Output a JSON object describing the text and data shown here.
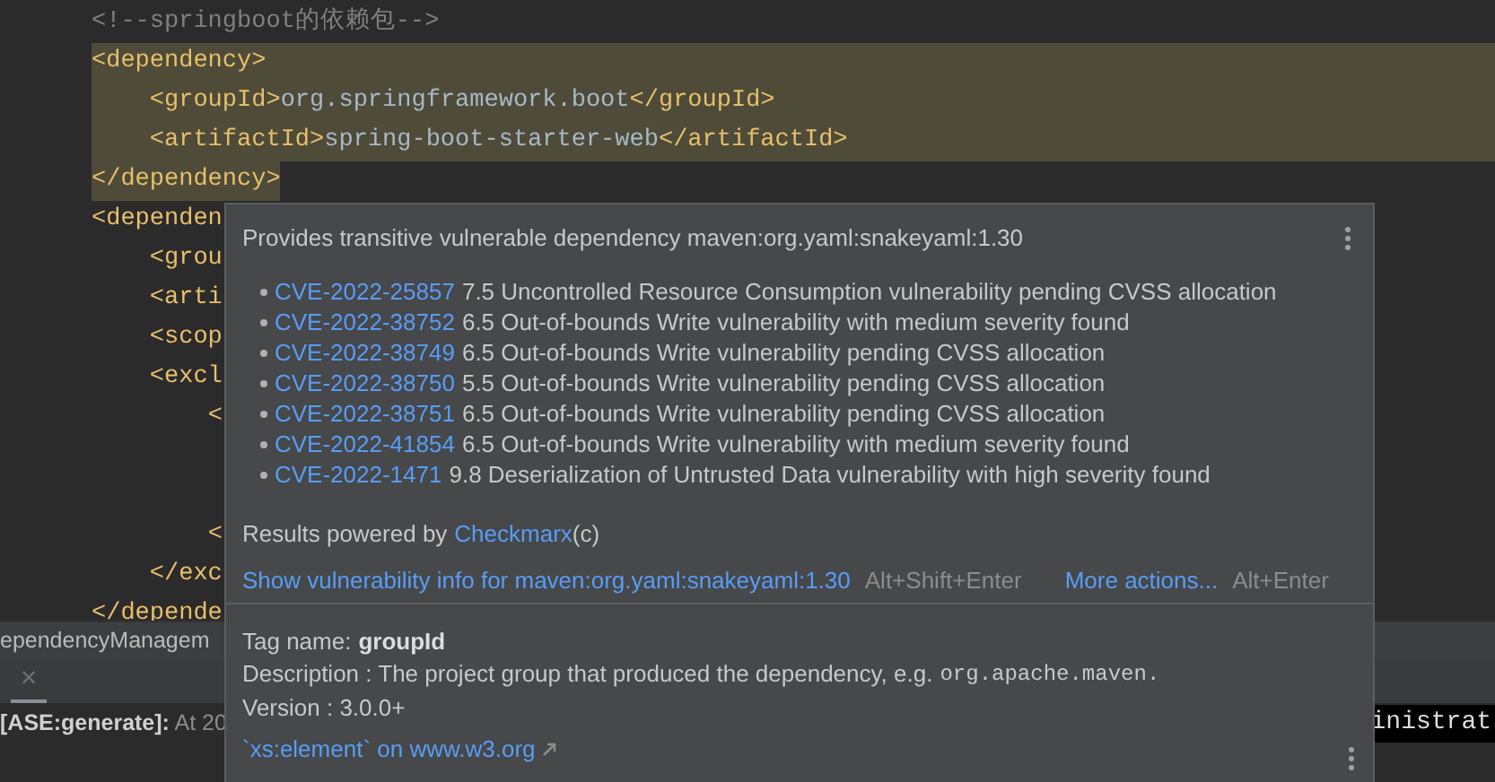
{
  "editor": {
    "lines": [
      {
        "text": "<!--springboot的依赖包-->",
        "kind": "comment",
        "selected": false
      },
      {
        "text": "<dependency>",
        "kind": "code",
        "selected": true
      },
      {
        "text": "    <groupId>org.springframework.boot</groupId>",
        "kind": "code",
        "selected": true
      },
      {
        "text": "    <artifactId>spring-boot-starter-web</artifactId>",
        "kind": "code",
        "selected": true
      },
      {
        "text": "</dependency>",
        "kind": "code",
        "selected": true
      },
      {
        "text": "<dependen",
        "kind": "code",
        "selected": false
      },
      {
        "text": "    <grou",
        "kind": "code",
        "selected": false
      },
      {
        "text": "    <arti",
        "kind": "code",
        "selected": false
      },
      {
        "text": "    <scop",
        "kind": "code",
        "selected": false
      },
      {
        "text": "    <excl",
        "kind": "code",
        "selected": false
      },
      {
        "text": "        <",
        "kind": "code",
        "selected": false
      },
      {
        "selected": false
      },
      {
        "selected": false
      },
      {
        "text": "        <",
        "kind": "code",
        "selected": false
      },
      {
        "text": "    </exc",
        "kind": "code",
        "selected": false
      },
      {
        "text": "</depende",
        "kind": "code",
        "selected": false
      }
    ]
  },
  "popup": {
    "title": "Provides transitive vulnerable dependency maven:org.yaml:snakeyaml:1.30",
    "cves": [
      {
        "id": "CVE-2022-25857",
        "text": "7.5 Uncontrolled Resource Consumption vulnerability pending CVSS allocation"
      },
      {
        "id": "CVE-2022-38752",
        "text": "6.5 Out-of-bounds Write vulnerability with medium severity found"
      },
      {
        "id": "CVE-2022-38749",
        "text": "6.5 Out-of-bounds Write vulnerability pending CVSS allocation"
      },
      {
        "id": "CVE-2022-38750",
        "text": "5.5 Out-of-bounds Write vulnerability pending CVSS allocation"
      },
      {
        "id": "CVE-2022-38751",
        "text": "6.5 Out-of-bounds Write vulnerability pending CVSS allocation"
      },
      {
        "id": "CVE-2022-41854",
        "text": "6.5 Out-of-bounds Write vulnerability with medium severity found"
      },
      {
        "id": "CVE-2022-1471",
        "text": "9.8 Deserialization of Untrusted Data vulnerability with high severity found"
      }
    ],
    "powered_by": {
      "text": "Results powered by",
      "link": "Checkmarx",
      "suffix": "(c)"
    },
    "actions": [
      {
        "label": "Show vulnerability info for maven:org.yaml:snakeyaml:1.30",
        "shortcut": "Alt+Shift+Enter"
      },
      {
        "label": "More actions...",
        "shortcut": "Alt+Enter"
      }
    ],
    "doc": {
      "tag_label": "Tag name:",
      "tag": "groupId",
      "description": "Description : The project group that produced the dependency, e.g.",
      "description_code": "org.apache.maven.",
      "version": "Version : 3.0.0+",
      "link": "`xs:element` on www.w3.org"
    }
  },
  "bottom_panel": {
    "tab": "ependencyManagem",
    "close": "×",
    "log": "**[ASE:generate]:** At 20",
    "right_text": "inistrat"
  }
}
